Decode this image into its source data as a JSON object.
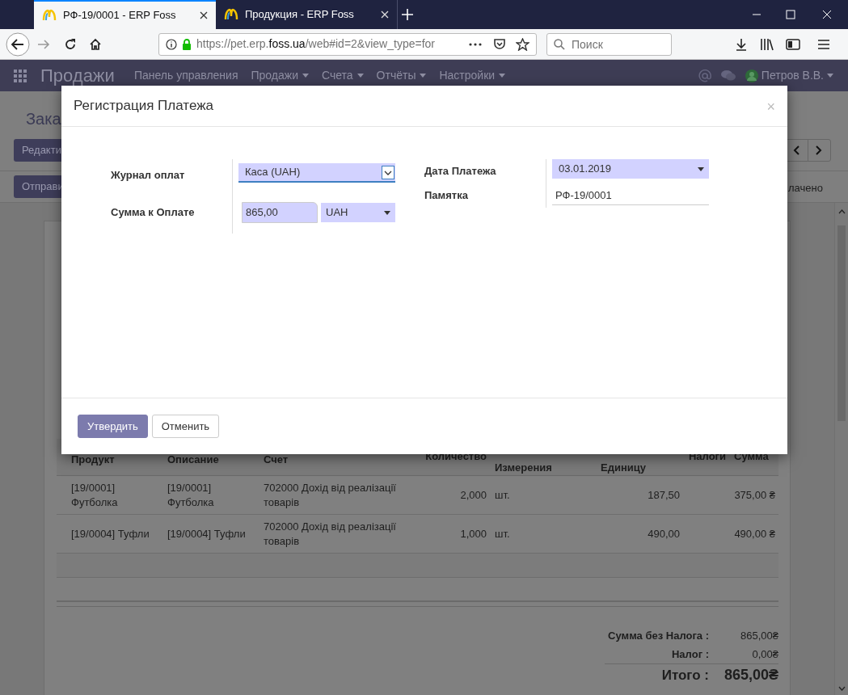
{
  "browser": {
    "tabs": [
      {
        "title": "РФ-19/0001 - ERP Foss",
        "selected": true
      },
      {
        "title": "Продукция - ERP Foss",
        "selected": false
      }
    ],
    "url": {
      "prefix": "https://pet.erp.",
      "domain": "foss.ua",
      "rest": "/web#id=2&view_type=for"
    },
    "search": {
      "placeholder": "Поиск"
    }
  },
  "app": {
    "title": "Продажи",
    "menu": [
      {
        "label": "Панель управления",
        "dropdown": false
      },
      {
        "label": "Продажи",
        "dropdown": true
      },
      {
        "label": "Счета",
        "dropdown": true
      },
      {
        "label": "Отчёты",
        "dropdown": true
      },
      {
        "label": "Настройки",
        "dropdown": true
      }
    ],
    "user": "Петров В.В."
  },
  "background": {
    "title": "Зака",
    "buttons": [
      "Редакти",
      "Отправи"
    ],
    "status": "лачено"
  },
  "table": {
    "columns": [
      "Продукт",
      "Описание",
      "Счет",
      "Количество",
      "Измерения",
      "Единицу",
      "Налоги",
      "Сумма"
    ],
    "rows": [
      [
        "[19/0001] Футболка",
        "[19/0001] Футболка",
        "702000 Дохід від реалізації товарів",
        "2,000",
        "шт.",
        "187,50",
        "",
        "375,00 ₴"
      ],
      [
        "[19/0004] Туфли",
        "[19/0004] Туфли",
        "702000 Дохід від реалізації товарів",
        "1,000",
        "шт.",
        "490,00",
        "",
        "490,00 ₴"
      ]
    ]
  },
  "totals": [
    {
      "label": "Сумма без Налога :",
      "value": "865,00₴",
      "kind": "line"
    },
    {
      "label": "Налог :",
      "value": "0,00₴",
      "kind": "line"
    },
    {
      "label": "Итого :",
      "value": "865,00₴",
      "kind": "total"
    }
  ],
  "dialog": {
    "title": "Регистрация Платежа",
    "close": "×",
    "left": [
      {
        "label": "Журнал оплат",
        "kind": "select",
        "value": "Каса (UAH)"
      },
      {
        "label": "Сумма к Оплате",
        "kind": "amount",
        "value": "865,00",
        "currency": "UAH"
      }
    ],
    "right": [
      {
        "label": "Дата Платежа",
        "kind": "date",
        "value": "03.01.2019"
      },
      {
        "label": "Памятка",
        "kind": "text",
        "value": "РФ-19/0001"
      }
    ],
    "buttons": [
      {
        "label": "Утвердить",
        "primary": true
      },
      {
        "label": "Отменить",
        "primary": false
      }
    ]
  }
}
